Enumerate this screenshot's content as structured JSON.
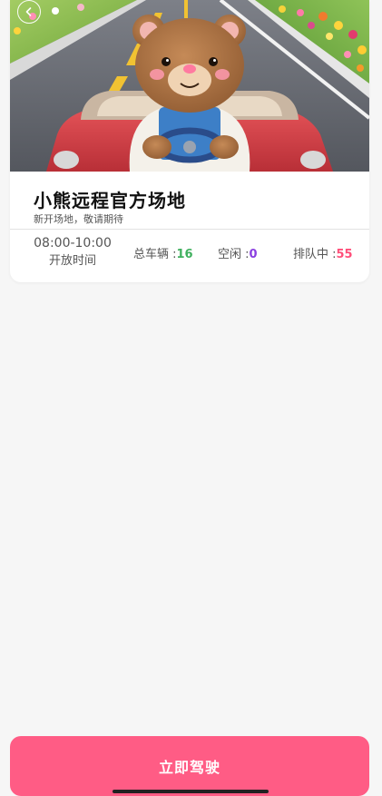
{
  "venue": {
    "name": "小熊远程官方场地",
    "subtitle": "新开场地，敬请期待"
  },
  "hours": {
    "range": "08:00-10:00",
    "label": "开放时间"
  },
  "stats": {
    "total_label": "总车辆 :",
    "total_value": "16",
    "idle_label": "空闲 :",
    "idle_value": "0",
    "queue_label": "排队中 :",
    "queue_value": "55"
  },
  "action": {
    "drive_label": "立即驾驶"
  },
  "colors": {
    "accent": "#ff5c85",
    "total": "#3fb05e",
    "idle": "#8a3fe0",
    "queue": "#ff4f7a"
  },
  "icons": {
    "back": "back-arrow-icon"
  }
}
